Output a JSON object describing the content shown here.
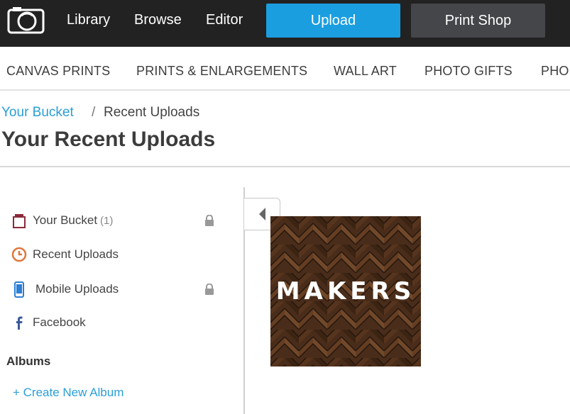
{
  "topnav": {
    "links": [
      "Library",
      "Browse",
      "Editor"
    ],
    "upload_label": "Upload",
    "print_shop_label": "Print Shop"
  },
  "categories": [
    "CANVAS PRINTS",
    "PRINTS & ENLARGEMENTS",
    "WALL ART",
    "PHOTO GIFTS",
    "PHO"
  ],
  "breadcrumb": {
    "parent": "Your Bucket",
    "separator": "/",
    "current": "Recent Uploads"
  },
  "page_title": "Your Recent Uploads",
  "sidebar": {
    "items": [
      {
        "label": "Your Bucket",
        "count": "(1)",
        "icon": "bucket-icon",
        "locked": true
      },
      {
        "label": "Recent Uploads",
        "icon": "clock-icon",
        "locked": false
      },
      {
        "label": "Mobile Uploads",
        "icon": "phone-icon",
        "locked": true
      },
      {
        "label": "Facebook",
        "icon": "facebook-icon",
        "locked": false
      }
    ],
    "albums_heading": "Albums",
    "create_album_label": "+ Create New Album"
  },
  "photos": [
    {
      "overlay_text": "MAKERS"
    }
  ],
  "colors": {
    "topbar": "#222222",
    "upload": "#1b9ee0",
    "print_shop": "#444649",
    "link": "#2a9fd6"
  }
}
